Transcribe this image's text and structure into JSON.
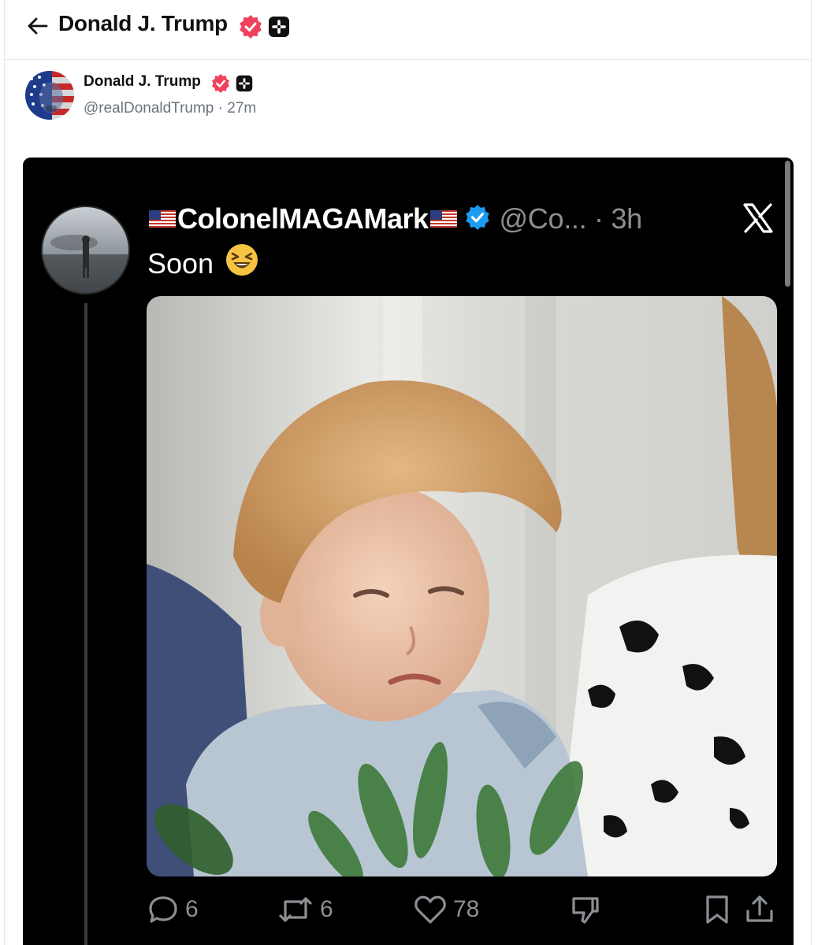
{
  "header": {
    "title": "Donald J. Trump"
  },
  "post": {
    "author_name": "Donald J. Trump",
    "author_handle": "@realDonaldTrump",
    "separator": "·",
    "time": "27m"
  },
  "embed": {
    "name": "ColonelMAGAMark",
    "handle": "@Co...",
    "separator": "·",
    "time": "3h",
    "text": "Soon",
    "actions": {
      "replies": "6",
      "reposts": "6",
      "likes": "78"
    }
  },
  "colors": {
    "verified_badge": "#f0425e",
    "embed_verified": "#1d9bf0",
    "embed_bg": "#000000"
  },
  "icons": [
    "back-arrow-icon",
    "verified-badge-icon",
    "plus-badge-icon",
    "x-logo-icon",
    "reply-icon",
    "repost-icon",
    "like-icon",
    "dislike-icon",
    "bookmark-icon",
    "share-icon",
    "us-flag-icon",
    "laughing-emoji-icon"
  ]
}
